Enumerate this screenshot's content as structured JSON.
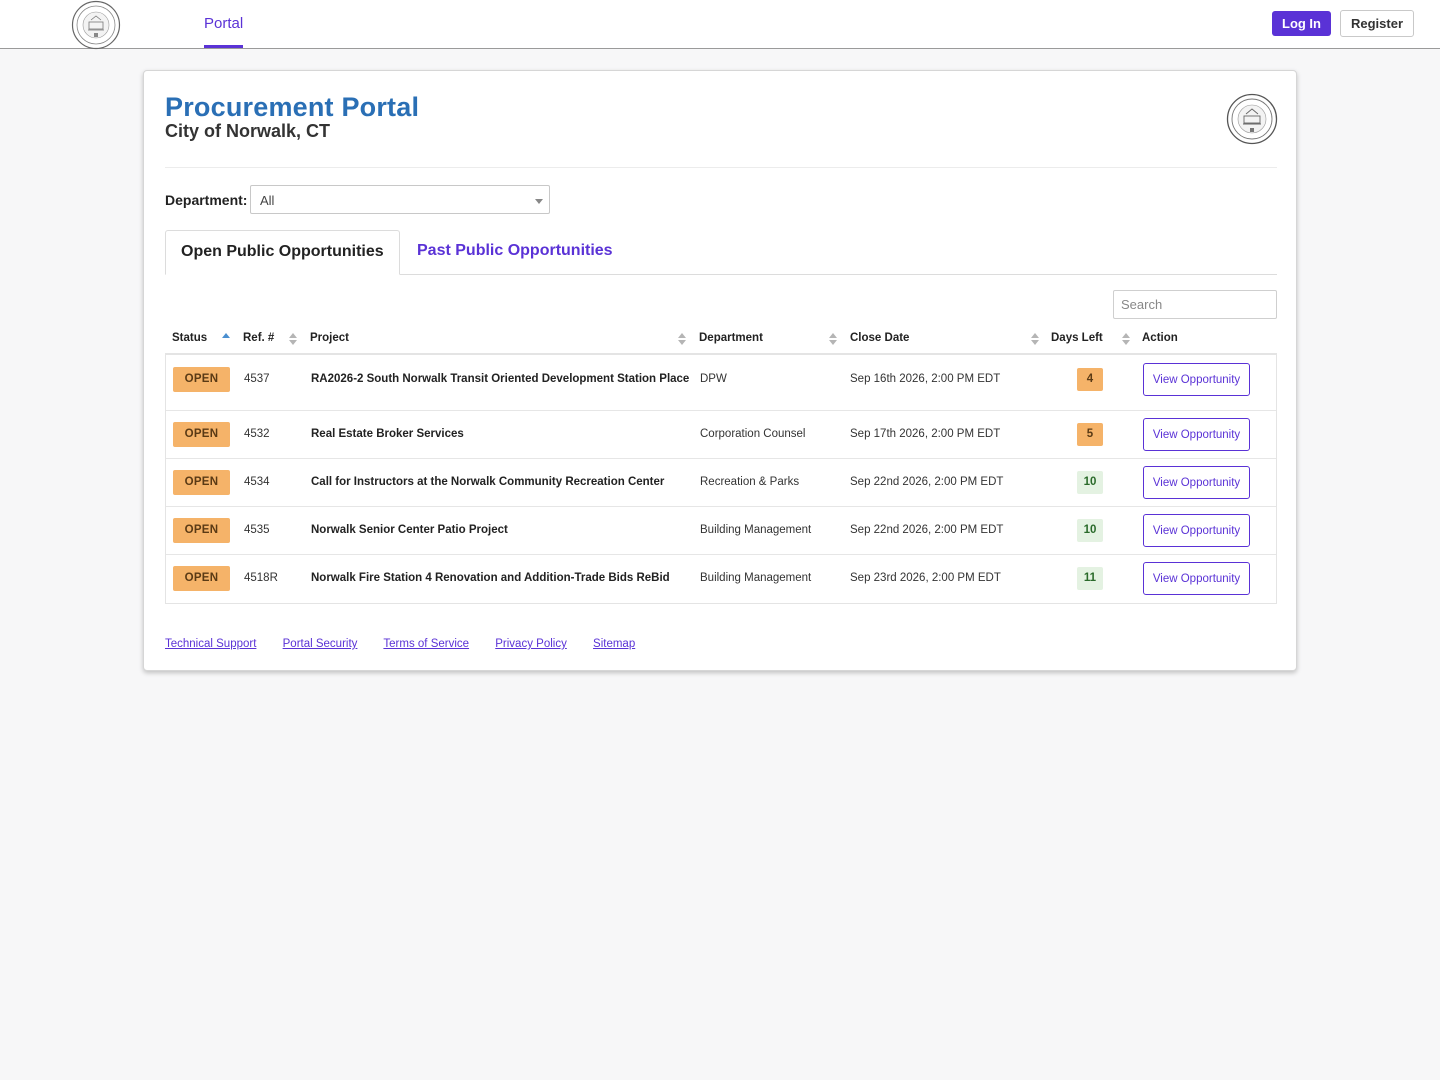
{
  "nav": {
    "tab_label": "Portal",
    "login_label": "Log In",
    "register_label": "Register"
  },
  "header": {
    "title": "Procurement Portal",
    "subtitle": "City of Norwalk, CT"
  },
  "filter": {
    "department_label": "Department:",
    "department_value": "All"
  },
  "tabs": [
    {
      "label": "Open Public Opportunities",
      "active": true
    },
    {
      "label": "Past Public Opportunities",
      "active": false
    }
  ],
  "search": {
    "placeholder": "Search"
  },
  "table": {
    "columns": [
      "Status",
      "Ref. #",
      "Project",
      "Department",
      "Close Date",
      "Days Left",
      "Action"
    ],
    "rows": [
      {
        "status": "OPEN",
        "ref": "4537",
        "project": "RA2026-2 South Norwalk Transit Oriented Development Station Place",
        "department": "DPW",
        "close_date": "Sep 16th 2026, 2:00 PM EDT",
        "days_left": "4",
        "action": "View Opportunity"
      },
      {
        "status": "OPEN",
        "ref": "4532",
        "project": "Real Estate Broker Services",
        "department": "Corporation Counsel",
        "close_date": "Sep 17th 2026, 2:00 PM EDT",
        "days_left": "5",
        "action": "View Opportunity"
      },
      {
        "status": "OPEN",
        "ref": "4534",
        "project": "Call for Instructors at the Norwalk Community Recreation Center",
        "department": "Recreation & Parks",
        "close_date": "Sep 22nd 2026, 2:00 PM EDT",
        "days_left": "10",
        "action": "View Opportunity"
      },
      {
        "status": "OPEN",
        "ref": "4535",
        "project": "Norwalk Senior Center Patio Project",
        "department": "Building Management",
        "close_date": "Sep 22nd 2026, 2:00 PM EDT",
        "days_left": "10",
        "action": "View Opportunity"
      },
      {
        "status": "OPEN",
        "ref": "4518R",
        "project": "Norwalk Fire Station 4 Renovation and Addition-Trade Bids ReBid",
        "department": "Building Management",
        "close_date": "Sep 23rd 2026, 2:00 PM EDT",
        "days_left": "11",
        "action": "View Opportunity"
      }
    ]
  },
  "footer": {
    "links": [
      "Technical Support",
      "Portal Security",
      "Terms of Service",
      "Privacy Policy",
      "Sitemap"
    ]
  },
  "colors": {
    "accent": "#5a32d6",
    "title_blue": "#2a6fb5",
    "open_badge": "#f5b369",
    "days_ok": "#e4f2e2"
  }
}
